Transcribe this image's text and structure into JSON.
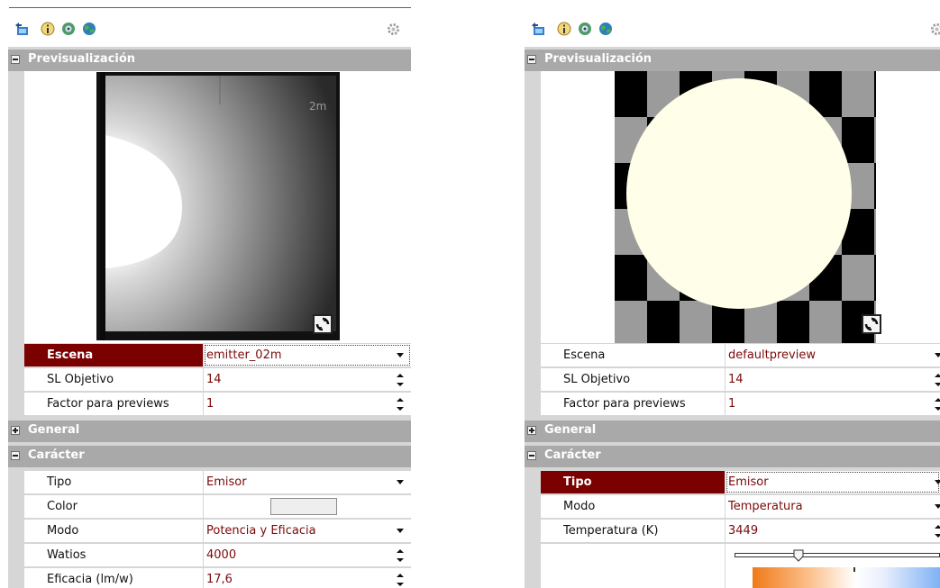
{
  "left_panel": {
    "icons": [
      "back-icon",
      "info-icon",
      "camera-icon",
      "globe-icon",
      "gear-icon"
    ],
    "sections": {
      "preview": {
        "title": "Previsualización",
        "expanded": true,
        "scene_label_overlay": "2m"
      },
      "general": {
        "title": "General",
        "expanded": false
      },
      "character": {
        "title": "Carácter",
        "expanded": true
      }
    },
    "preview_props": [
      {
        "label": "Escena",
        "value": "emitter_02m",
        "control": "dropdown",
        "selected": true
      },
      {
        "label": "SL Objetivo",
        "value": "14",
        "control": "spinner"
      },
      {
        "label": "Factor para previews",
        "value": "1",
        "control": "spinner"
      }
    ],
    "character_props": [
      {
        "label": "Tipo",
        "value": "Emisor",
        "control": "dropdown"
      },
      {
        "label": "Color",
        "value": "",
        "control": "color",
        "color": "#eeeeee"
      },
      {
        "label": "Modo",
        "value": "Potencia y Eficacia",
        "control": "dropdown"
      },
      {
        "label": "Watios",
        "value": "4000",
        "control": "spinner"
      },
      {
        "label": "Eficacia (lm/w)",
        "value": "17,6",
        "control": "spinner"
      }
    ]
  },
  "right_panel": {
    "icons": [
      "back-icon",
      "info-icon",
      "camera-icon",
      "globe-icon",
      "gear-icon"
    ],
    "sections": {
      "preview": {
        "title": "Previsualización",
        "expanded": true
      },
      "general": {
        "title": "General",
        "expanded": false
      },
      "character": {
        "title": "Carácter",
        "expanded": true
      }
    },
    "preview_props": [
      {
        "label": "Escena",
        "value": "defaultpreview",
        "control": "dropdown"
      },
      {
        "label": "SL Objetivo",
        "value": "14",
        "control": "spinner"
      },
      {
        "label": "Factor para previews",
        "value": "1",
        "control": "spinner"
      }
    ],
    "character_props": [
      {
        "label": "Tipo",
        "value": "Emisor",
        "control": "dropdown",
        "selected": true
      },
      {
        "label": "Modo",
        "value": "Temperatura",
        "control": "dropdown"
      },
      {
        "label": "Temperatura (K)",
        "value": "3449",
        "control": "spinner"
      }
    ],
    "temperature_slider": {
      "position": 0.31
    }
  },
  "colors": {
    "selected_row": "#7b0000",
    "value_text": "#7b0a0a",
    "section_header": "#a9a9a9",
    "sphere": "#fffee8"
  }
}
